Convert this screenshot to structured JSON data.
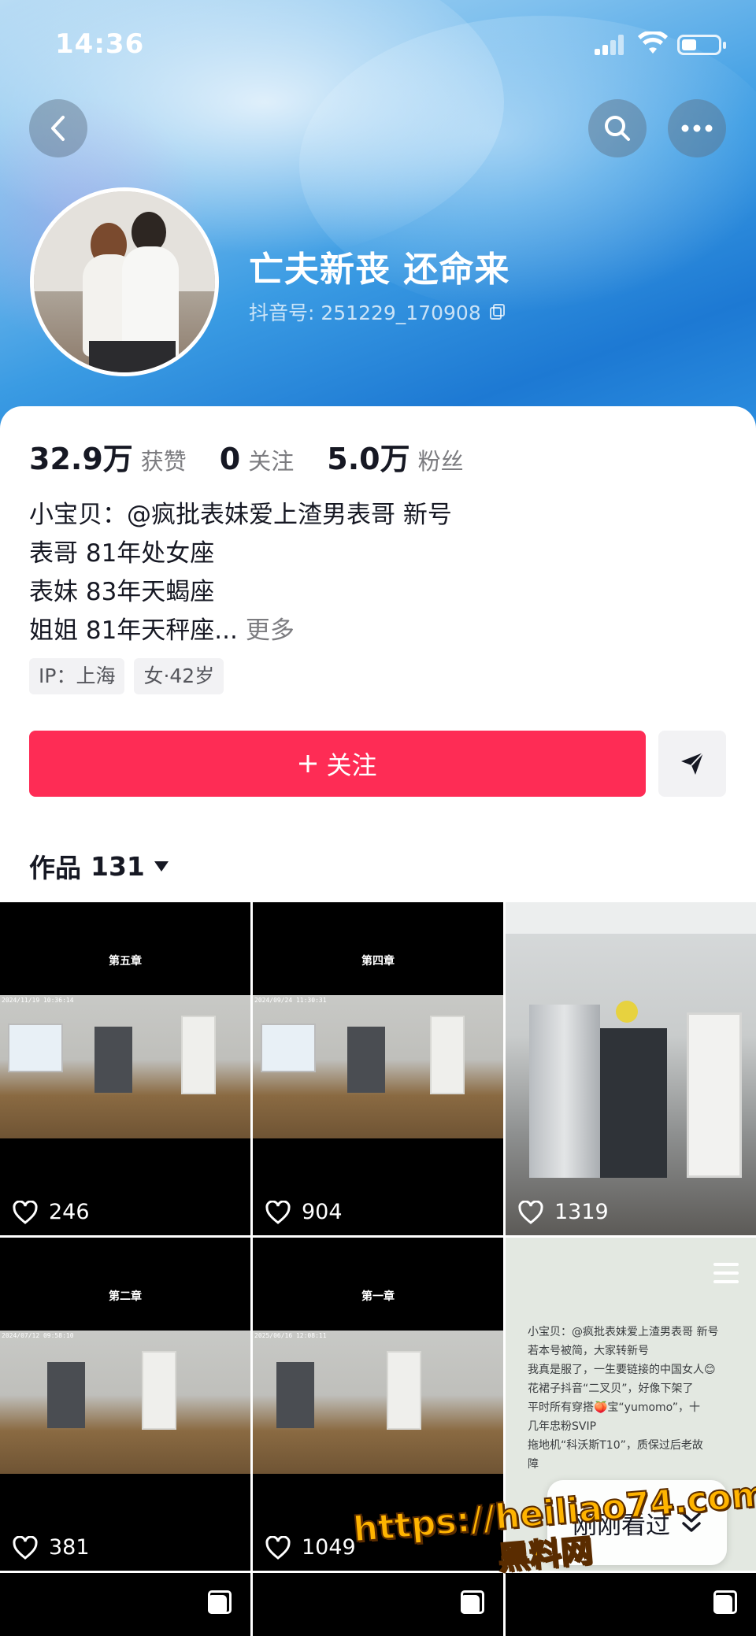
{
  "status_bar": {
    "time": "14:36"
  },
  "profile": {
    "nickname": "亡夫新丧 还命来",
    "douyin_id": "抖音号: 251229_170908",
    "stats": [
      {
        "value": "32.9万",
        "label": "获赞"
      },
      {
        "value": "0",
        "label": "关注"
      },
      {
        "value": "5.0万",
        "label": "粉丝"
      }
    ],
    "bio_lines": [
      "小宝贝：@疯批表妹爱上渣男表哥 新号",
      "表哥 81年处女座",
      "表妹 83年天蝎座",
      "姐姐 81年天秤座..."
    ],
    "bio_more": "更多",
    "tags": [
      "IP：上海",
      "女·42岁"
    ]
  },
  "actions": {
    "follow_label": "关注"
  },
  "works_tab": {
    "label": "作品",
    "count": "131"
  },
  "grid": [
    {
      "chapter": "第五章",
      "stamp": "2024/11/19 10:36:14",
      "likes": "246"
    },
    {
      "chapter": "第四章",
      "stamp": "2024/09/24 11:30:31",
      "likes": "904"
    },
    {
      "likes": "1319"
    },
    {
      "chapter": "第二章",
      "stamp": "2024/07/12 09:58:10",
      "likes": "381"
    },
    {
      "chapter": "第一章",
      "stamp": "2025/06/16 12:08:11",
      "likes": "1049"
    }
  ],
  "text_tile": {
    "lines": [
      "小宝贝：@疯批表妹爱上渣男表哥 新号",
      "若本号被简，大家转新号",
      "我真是服了，一生要链接的中国女人😊",
      "花裙子抖音“二叉贝”，好像下架了",
      "平时所有穿搭🍑宝“yumomo”，十",
      "几年忠粉SVIP",
      "拖地机“科沃斯T10”，质保过后老故",
      "障"
    ]
  },
  "recent_pill": {
    "label": "刚刚看过"
  },
  "watermark": {
    "line1": "https://heiliao74.com",
    "line2": "黑料网"
  },
  "colors": {
    "accent": "#fe2c55"
  }
}
